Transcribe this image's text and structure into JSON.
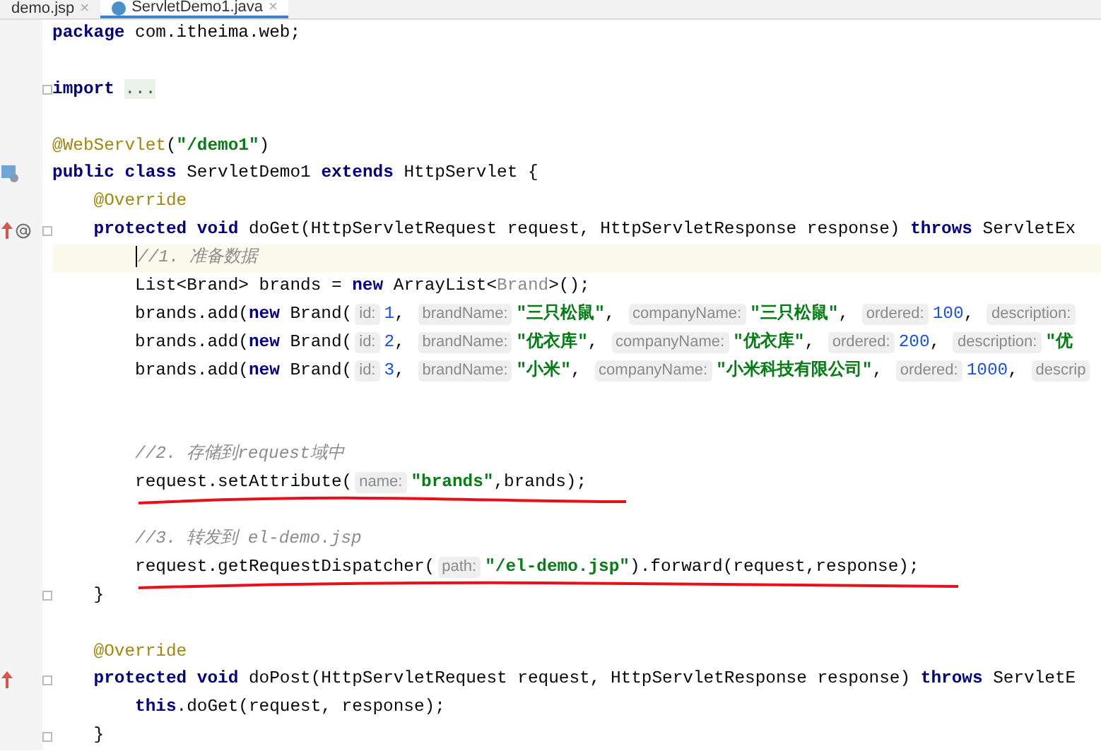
{
  "tabs": [
    {
      "label": "demo.jsp",
      "selected": false,
      "close": "×"
    },
    {
      "label": "ServletDemo1.java",
      "selected": true,
      "close": "×"
    }
  ],
  "lines": [
    {
      "tokens": [
        {
          "kind": "keyword",
          "text": "package"
        },
        {
          "kind": "plain",
          "text": " com.itheima.web;"
        }
      ]
    },
    {
      "gap_before": true,
      "fold": true,
      "tokens": [
        {
          "kind": "keyword",
          "text": "import"
        },
        {
          "kind": "folded",
          "text": "..."
        }
      ]
    },
    {
      "gap_before": true,
      "tokens": [
        {
          "kind": "annotation",
          "text": "@WebServlet"
        },
        {
          "kind": "plain",
          "text": "("
        },
        {
          "kind": "string",
          "text": "\"/demo1\""
        },
        {
          "kind": "plain",
          "text": ")"
        }
      ]
    },
    {
      "servlet_icon": true,
      "tokens": [
        {
          "kind": "keyword",
          "text": "public"
        },
        {
          "kind": "keyword",
          "text": " class"
        },
        {
          "kind": "plain",
          "text": " ServletDemo1 "
        },
        {
          "kind": "keyword",
          "text": "extends"
        },
        {
          "kind": "plain",
          "text": " HttpServlet {"
        }
      ]
    },
    {
      "tokens": [
        {
          "kind": "annotation",
          "text": "    @Override"
        }
      ]
    },
    {
      "overrides": true,
      "annotated": true,
      "fold": true,
      "tokens": [
        {
          "kind": "keyword",
          "text": "    protected"
        },
        {
          "kind": "keyword",
          "text": " void"
        },
        {
          "kind": "plain",
          "text": " doGet(HttpServletRequest request, HttpServletResponse response) "
        },
        {
          "kind": "keyword",
          "text": "throws"
        },
        {
          "kind": "plain",
          "text": " ServletEx"
        }
      ]
    },
    {
      "current": true,
      "tokens": [
        {
          "kind": "comment",
          "text": "        //1. 准备数据"
        }
      ]
    },
    {
      "tokens": [
        {
          "kind": "plain",
          "text": "        List<Brand> brands = "
        },
        {
          "kind": "keyword",
          "text": "new"
        },
        {
          "kind": "plain",
          "text": " ArrayList<"
        },
        {
          "kind": "dim",
          "text": "Brand"
        },
        {
          "kind": "plain",
          "text": ">();"
        }
      ]
    },
    {
      "tokens": [
        {
          "kind": "plain",
          "text": "        brands.add("
        },
        {
          "kind": "keyword",
          "text": "new"
        },
        {
          "kind": "plain",
          "text": " Brand("
        },
        {
          "kind": "hint",
          "text": "id:"
        },
        {
          "kind": "number",
          "text": "1"
        },
        {
          "kind": "plain",
          "text": ", "
        },
        {
          "kind": "hint",
          "text": "brandName:"
        },
        {
          "kind": "string",
          "text": "\"三只松鼠\""
        },
        {
          "kind": "plain",
          "text": ", "
        },
        {
          "kind": "hint",
          "text": "companyName:"
        },
        {
          "kind": "string",
          "text": "\"三只松鼠\""
        },
        {
          "kind": "plain",
          "text": ", "
        },
        {
          "kind": "hint",
          "text": "ordered:"
        },
        {
          "kind": "number",
          "text": "100"
        },
        {
          "kind": "plain",
          "text": ", "
        },
        {
          "kind": "hint",
          "text": "description:"
        }
      ]
    },
    {
      "tokens": [
        {
          "kind": "plain",
          "text": "        brands.add("
        },
        {
          "kind": "keyword",
          "text": "new"
        },
        {
          "kind": "plain",
          "text": " Brand("
        },
        {
          "kind": "hint",
          "text": "id:"
        },
        {
          "kind": "number",
          "text": "2"
        },
        {
          "kind": "plain",
          "text": ", "
        },
        {
          "kind": "hint",
          "text": "brandName:"
        },
        {
          "kind": "string",
          "text": "\"优衣库\""
        },
        {
          "kind": "plain",
          "text": ", "
        },
        {
          "kind": "hint",
          "text": "companyName:"
        },
        {
          "kind": "string",
          "text": "\"优衣库\""
        },
        {
          "kind": "plain",
          "text": ", "
        },
        {
          "kind": "hint",
          "text": "ordered:"
        },
        {
          "kind": "number",
          "text": "200"
        },
        {
          "kind": "plain",
          "text": ", "
        },
        {
          "kind": "hint",
          "text": "description:"
        },
        {
          "kind": "string",
          "text": "\"优"
        }
      ]
    },
    {
      "tokens": [
        {
          "kind": "plain",
          "text": "        brands.add("
        },
        {
          "kind": "keyword",
          "text": "new"
        },
        {
          "kind": "plain",
          "text": " Brand("
        },
        {
          "kind": "hint",
          "text": "id:"
        },
        {
          "kind": "number",
          "text": "3"
        },
        {
          "kind": "plain",
          "text": ", "
        },
        {
          "kind": "hint",
          "text": "brandName:"
        },
        {
          "kind": "string",
          "text": "\"小米\""
        },
        {
          "kind": "plain",
          "text": ", "
        },
        {
          "kind": "hint",
          "text": "companyName:"
        },
        {
          "kind": "string",
          "text": "\"小米科技有限公司\""
        },
        {
          "kind": "plain",
          "text": ", "
        },
        {
          "kind": "hint",
          "text": "ordered:"
        },
        {
          "kind": "number",
          "text": "1000"
        },
        {
          "kind": "plain",
          "text": ", "
        },
        {
          "kind": "hint",
          "text": "descrip"
        }
      ]
    },
    {
      "gap_before": true,
      "wide_gap_before": true,
      "tokens": [
        {
          "kind": "comment",
          "text": "        //2. 存储到request域中"
        }
      ]
    },
    {
      "underline": true,
      "tokens": [
        {
          "kind": "plain",
          "text": "        request.setAttribute("
        },
        {
          "kind": "hint",
          "text": "name:"
        },
        {
          "kind": "string",
          "text": "\"brands\""
        },
        {
          "kind": "plain",
          "text": ",brands);"
        }
      ]
    },
    {
      "gap_before": true,
      "tokens": [
        {
          "kind": "comment",
          "text": "        //3. 转发到 el-demo.jsp"
        }
      ]
    },
    {
      "underline": true,
      "tokens": [
        {
          "kind": "plain",
          "text": "        request.getRequestDispatcher("
        },
        {
          "kind": "hint",
          "text": "path:"
        },
        {
          "kind": "string",
          "text": "\"/el-demo.jsp\""
        },
        {
          "kind": "plain",
          "text": ").forward(request,response);"
        }
      ]
    },
    {
      "fold": true,
      "tokens": [
        {
          "kind": "plain",
          "text": "    }"
        }
      ]
    },
    {
      "gap_before": true,
      "tokens": [
        {
          "kind": "annotation",
          "text": "    @Override"
        }
      ]
    },
    {
      "overrides": true,
      "fold": true,
      "tokens": [
        {
          "kind": "keyword",
          "text": "    protected"
        },
        {
          "kind": "keyword",
          "text": " void"
        },
        {
          "kind": "plain",
          "text": " doPost(HttpServletRequest request, HttpServletResponse response) "
        },
        {
          "kind": "keyword",
          "text": "throws"
        },
        {
          "kind": "plain",
          "text": " ServletE"
        }
      ]
    },
    {
      "tokens": [
        {
          "kind": "keyword",
          "text": "        this"
        },
        {
          "kind": "plain",
          "text": ".doGet(request, response);"
        }
      ]
    },
    {
      "fold": true,
      "tokens": [
        {
          "kind": "plain",
          "text": "    }"
        }
      ]
    }
  ]
}
